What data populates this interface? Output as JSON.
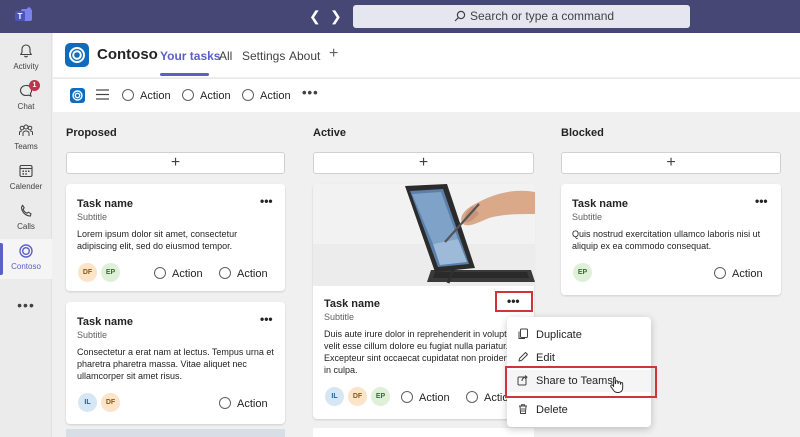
{
  "topbar": {
    "back_arrow": "❮",
    "forward_arrow": "❯",
    "search_placeholder": "Search or type a command"
  },
  "rail": {
    "items": [
      {
        "label": "Activity",
        "icon": "bell-icon"
      },
      {
        "label": "Chat",
        "icon": "chat-icon",
        "badge": "1"
      },
      {
        "label": "Teams",
        "icon": "teams-icon"
      },
      {
        "label": "Calender",
        "icon": "calendar-icon"
      },
      {
        "label": "Calls",
        "icon": "phone-icon"
      },
      {
        "label": "Contoso",
        "icon": "contoso-icon"
      }
    ],
    "more": "•••"
  },
  "app": {
    "name": "Contoso",
    "tabs": [
      "Your tasks",
      "All",
      "Settings",
      "About"
    ],
    "add_tab": "+"
  },
  "toolbar": {
    "actions": [
      "Action",
      "Action",
      "Action"
    ],
    "more": "•••"
  },
  "board": {
    "columns": [
      {
        "title": "Proposed",
        "add": "+",
        "cards": [
          {
            "name": "Task name",
            "subtitle": "Subtitle",
            "body": "Lorem ipsum dolor sit amet, consectetur adipiscing elit, sed do eiusmod tempor.",
            "avatars": [
              "DF",
              "EP"
            ],
            "actions": [
              "Action",
              "Action"
            ],
            "more": "•••"
          },
          {
            "name": "Task name",
            "subtitle": "Subtitle",
            "body": "Consectetur a erat nam at lectus. Tempus urna et pharetra pharetra massa. Vitae aliquet nec ullamcorper sit amet risus.",
            "avatars": [
              "IL",
              "DF"
            ],
            "actions": [
              "Action"
            ],
            "more": "•••"
          }
        ]
      },
      {
        "title": "Active",
        "add": "+",
        "cards": [
          {
            "name": "Task name",
            "subtitle": "Subtitle",
            "body": "Duis aute irure dolor in reprehenderit in volupta velit esse cillum dolore eu fugiat nulla pariatur. Excepteur sint occaecat cupidatat non proident, s in culpa.",
            "avatars": [
              "IL",
              "DF",
              "EP"
            ],
            "actions": [
              "Action",
              "Actio"
            ],
            "more": "•••"
          }
        ]
      },
      {
        "title": "Blocked",
        "add": "+",
        "cards": [
          {
            "name": "Task name",
            "subtitle": "Subtitle",
            "body": "Quis nostrud exercitation ullamco laboris nisi ut aliquip ex ea commodo consequat.",
            "avatars": [
              "EP"
            ],
            "actions": [
              "Action"
            ],
            "more": "•••"
          }
        ]
      }
    ]
  },
  "context_menu": {
    "items": [
      {
        "label": "Duplicate",
        "icon": "copy-icon"
      },
      {
        "label": "Edit",
        "icon": "pencil-icon"
      },
      {
        "label": "Share to Teams",
        "icon": "share-icon"
      },
      {
        "label": "Delete",
        "icon": "trash-icon"
      }
    ]
  },
  "colors": {
    "topbar": "#464775",
    "accent": "#5b5fc7",
    "highlight": "#d13438",
    "app_blue": "#0f6cbd"
  }
}
